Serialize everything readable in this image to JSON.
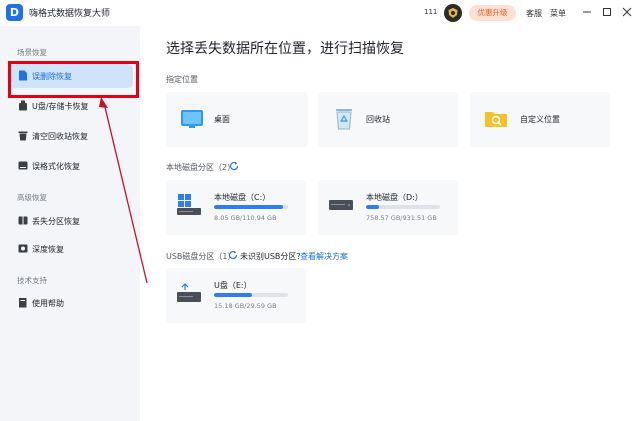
{
  "app": {
    "logo_letter": "D",
    "title": "嗨格式数据恢复大师"
  },
  "titlebar": {
    "count": "111",
    "upgrade": "优惠升级",
    "support": "客服",
    "menu": "菜单"
  },
  "sidebar": {
    "section_scene": "场景恢复",
    "items_scene": [
      {
        "label": "误删除恢复",
        "active": true
      },
      {
        "label": "U盘/存储卡恢复"
      },
      {
        "label": "清空回收站恢复"
      },
      {
        "label": "误格式化恢复"
      }
    ],
    "section_advanced": "高级恢复",
    "items_advanced": [
      {
        "label": "丢失分区恢复"
      },
      {
        "label": "深度恢复"
      }
    ],
    "section_support": "技术支持",
    "items_support": [
      {
        "label": "使用帮助"
      }
    ]
  },
  "main": {
    "title": "选择丢失数据所在位置，进行扫描恢复",
    "specified_label": "指定位置",
    "locations": [
      {
        "label": "桌面",
        "icon": "desktop-icon"
      },
      {
        "label": "回收站",
        "icon": "recycle-bin-icon"
      },
      {
        "label": "自定义位置",
        "icon": "folder-search-icon"
      }
    ],
    "local_label": "本地磁盘分区（2）",
    "local_disks": [
      {
        "name": "本地磁盘（C:）",
        "size": "8.05 GB/110.94 GB",
        "used_fraction": 0.93
      },
      {
        "name": "本地磁盘（D:）",
        "size": "758.57 GB/931.51 GB",
        "used_fraction": 0.18
      }
    ],
    "usb_label": "USB磁盘分区（1）",
    "usb_unrecognized": "未识别USB分区？",
    "usb_solution": "查看解决方案",
    "usb_disks": [
      {
        "name": "U盘（E:）",
        "size": "15.18 GB/29.59 GB",
        "used_fraction": 0.51
      }
    ]
  },
  "colors": {
    "accent": "#1f6fe5",
    "highlight": "#e60012",
    "upgrade": "#f05a1c"
  }
}
